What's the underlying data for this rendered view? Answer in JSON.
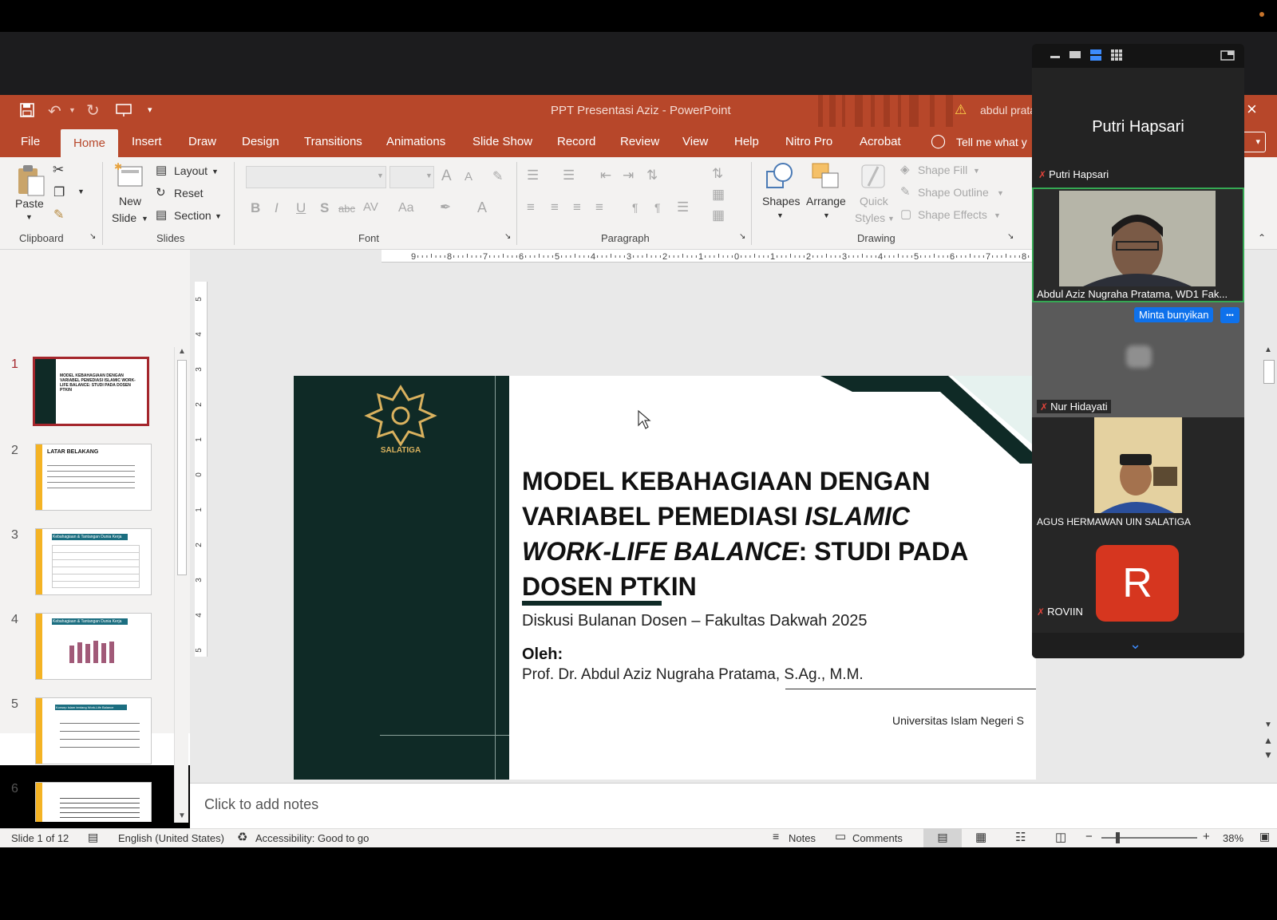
{
  "window": {
    "title": "PPT Presentasi Aziz",
    "app": "PowerPoint",
    "warning_text": "abdul prata"
  },
  "tabs": [
    "File",
    "Home",
    "Insert",
    "Draw",
    "Design",
    "Transitions",
    "Animations",
    "Slide Show",
    "Record",
    "Review",
    "View",
    "Help",
    "Nitro Pro",
    "Acrobat"
  ],
  "tell_me": "Tell me what y",
  "ribbon": {
    "clipboard": {
      "paste": "Paste",
      "label": "Clipboard"
    },
    "slides": {
      "new_slide_1": "New",
      "new_slide_2": "Slide",
      "layout": "Layout",
      "reset": "Reset",
      "section": "Section",
      "label": "Slides"
    },
    "font": {
      "label": "Font",
      "bold": "B",
      "italic": "I",
      "underline": "U",
      "shadow": "S",
      "strike": "abc",
      "grow": "A",
      "shrink": "A",
      "case": "Aa"
    },
    "paragraph": {
      "label": "Paragraph"
    },
    "drawing": {
      "label": "Drawing",
      "shapes": "Shapes",
      "arrange": "Arrange",
      "quick_styles_1": "Quick",
      "quick_styles_2": "Styles",
      "shape_fill": "Shape Fill",
      "shape_outline": "Shape Outline",
      "shape_effects": "Shape Effects"
    }
  },
  "ruler": {
    "ticks": [
      "9",
      "8",
      "7",
      "6",
      "5",
      "4",
      "3",
      "2",
      "1",
      "0",
      "1",
      "2",
      "3",
      "4",
      "5",
      "6",
      "7",
      "8"
    ]
  },
  "vruler": {
    "ticks": [
      "5",
      "4",
      "3",
      "2",
      "1",
      "0",
      "1",
      "2",
      "3",
      "4",
      "5"
    ]
  },
  "thumbnails": [
    {
      "num": "1",
      "title": "MODEL KEBAHAGIAAN DENGAN VARIABEL PEMEDIASI ISLAMIC WORK-LIFE BALANCE: STUDI PADA DOSEN PTKIN"
    },
    {
      "num": "2",
      "title": "LATAR BELAKANG"
    },
    {
      "num": "3",
      "title": "Kebahagiaan & Tantangan Dunia Kerja"
    },
    {
      "num": "4",
      "title": "Kebahagiaan & Tantangan Dunia Kerja"
    },
    {
      "num": "5",
      "title": "Konsep Islam tentang Work-Life Balance"
    },
    {
      "num": "6",
      "title": ""
    }
  ],
  "slide": {
    "logo_text": "SALATIGA",
    "title_part1": "MODEL KEBAHAGIAAN DENGAN VARIABEL PEMEDIASI ",
    "title_italic1": "ISLAMIC WORK-LIFE BALANCE",
    "title_part2": ": STUDI PADA DOSEN PTKIN",
    "line1": "VARIABEL PEMEDIASI",
    "subtitle": "Diskusi Bulanan Dosen – Fakultas Dakwah 2025",
    "by_label": "Oleh:",
    "author": "Prof. Dr. Abdul Aziz Nugraha Pratama, S.Ag., M.M.",
    "institution": "Universitas Islam Negeri S"
  },
  "notes_placeholder": "Click to add notes",
  "status": {
    "slide_count": "Slide 1 of 12",
    "language": "English (United States)",
    "accessibility": "Accessibility: Good to go",
    "notes": "Notes",
    "comments": "Comments",
    "zoom": "38%"
  },
  "zoom_meeting": {
    "speaker_name": "Putri Hapsari",
    "participants": [
      {
        "name": "Putri Hapsari",
        "muted": true
      },
      {
        "name": "Abdul Aziz Nugraha Pratama, WD1 Fak...",
        "muted": false,
        "active": true
      },
      {
        "name": "Nur Hidayati",
        "muted": true,
        "badge": "Minta bunyikan"
      },
      {
        "name": "AGUS HERMAWAN UIN SALATIGA",
        "muted": false
      },
      {
        "name": "ROVIIN",
        "muted": true,
        "avatar_letter": "R"
      }
    ],
    "more_label": "•••",
    "accent": "#35a853",
    "avatar_color": "#d6361f"
  }
}
